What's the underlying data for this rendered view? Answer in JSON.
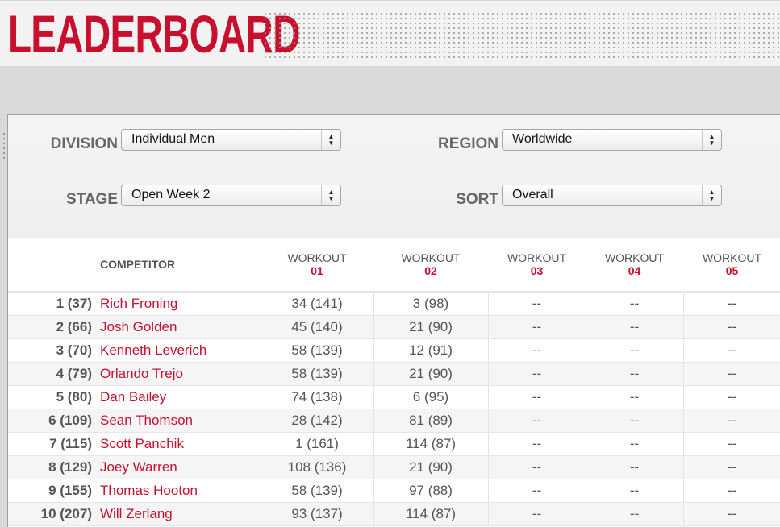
{
  "header": {
    "title": "LEADERBOARD"
  },
  "filters": {
    "division": {
      "label": "DIVISION",
      "value": "Individual Men"
    },
    "region": {
      "label": "REGION",
      "value": "Worldwide"
    },
    "stage": {
      "label": "STAGE",
      "value": "Open Week 2"
    },
    "sort": {
      "label": "SORT",
      "value": "Overall"
    }
  },
  "table": {
    "competitor_header": "COMPETITOR",
    "workouts": [
      {
        "label": "WORKOUT",
        "number": "01"
      },
      {
        "label": "WORKOUT",
        "number": "02"
      },
      {
        "label": "WORKOUT",
        "number": "03"
      },
      {
        "label": "WORKOUT",
        "number": "04"
      },
      {
        "label": "WORKOUT",
        "number": "05"
      }
    ],
    "rows": [
      {
        "rank": "1 (37)",
        "name": "Rich Froning",
        "scores": [
          "34 (141)",
          "3 (98)",
          "--",
          "--",
          "--"
        ]
      },
      {
        "rank": "2 (66)",
        "name": "Josh Golden",
        "scores": [
          "45 (140)",
          "21 (90)",
          "--",
          "--",
          "--"
        ]
      },
      {
        "rank": "3 (70)",
        "name": "Kenneth Leverich",
        "scores": [
          "58 (139)",
          "12 (91)",
          "--",
          "--",
          "--"
        ]
      },
      {
        "rank": "4 (79)",
        "name": "Orlando Trejo",
        "scores": [
          "58 (139)",
          "21 (90)",
          "--",
          "--",
          "--"
        ]
      },
      {
        "rank": "5 (80)",
        "name": "Dan Bailey",
        "scores": [
          "74 (138)",
          "6 (95)",
          "--",
          "--",
          "--"
        ]
      },
      {
        "rank": "6 (109)",
        "name": "Sean Thomson",
        "scores": [
          "28 (142)",
          "81 (89)",
          "--",
          "--",
          "--"
        ]
      },
      {
        "rank": "7 (115)",
        "name": "Scott Panchik",
        "scores": [
          "1 (161)",
          "114 (87)",
          "--",
          "--",
          "--"
        ]
      },
      {
        "rank": "8 (129)",
        "name": "Joey Warren",
        "scores": [
          "108 (136)",
          "21 (90)",
          "--",
          "--",
          "--"
        ]
      },
      {
        "rank": "9 (155)",
        "name": "Thomas Hooton",
        "scores": [
          "58 (139)",
          "97 (88)",
          "--",
          "--",
          "--"
        ]
      },
      {
        "rank": "10 (207)",
        "name": "Will Zerlang",
        "scores": [
          "93 (137)",
          "114 (87)",
          "--",
          "--",
          "--"
        ]
      }
    ]
  },
  "colors": {
    "brand_red": "#c8102e",
    "label_gray": "#666666"
  }
}
